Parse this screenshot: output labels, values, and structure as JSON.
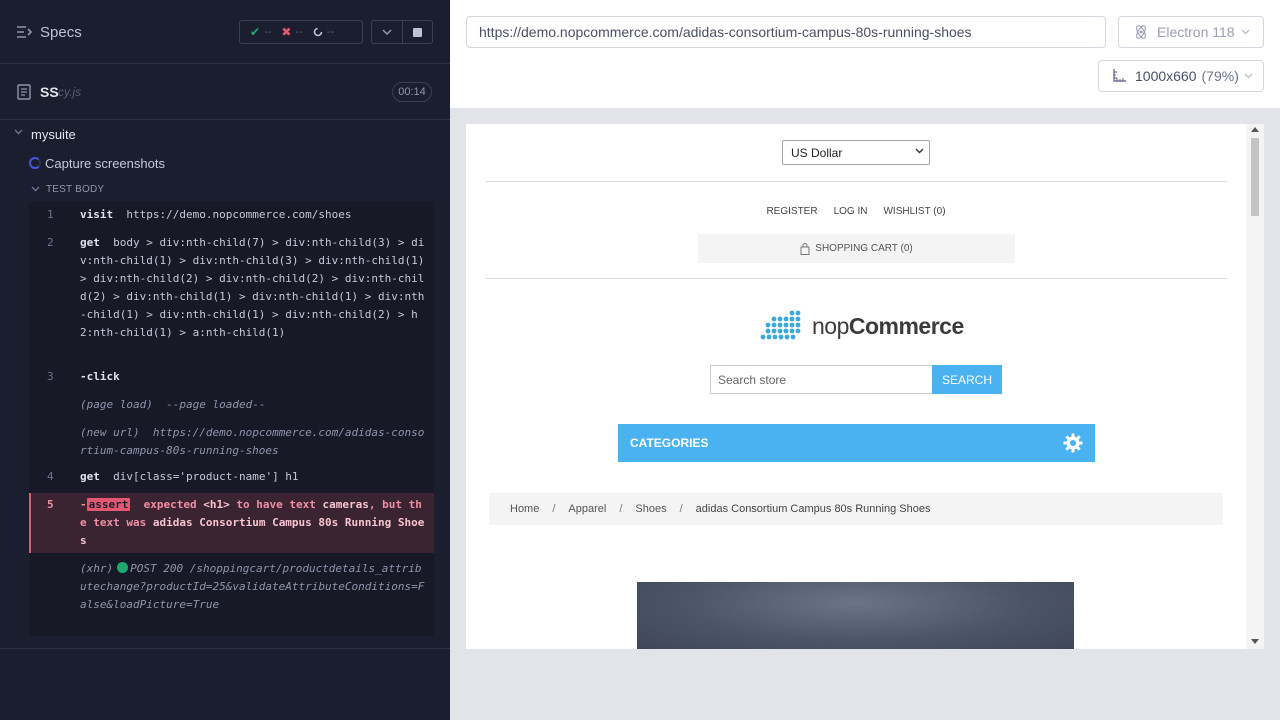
{
  "reporter": {
    "header": {
      "title": "Specs",
      "stats": {
        "passed": "--",
        "failed": "--",
        "pending": "--"
      }
    },
    "file": {
      "name": "SS",
      "ext": "cy.js",
      "duration": "00:14"
    },
    "suite": {
      "title": "mysuite"
    },
    "test": {
      "title": "Capture screenshots"
    },
    "body_label": "TEST BODY",
    "commands": [
      {
        "num": "1",
        "name": "visit",
        "message": "https://demo.nopcommerce.com/shoes"
      },
      {
        "num": "2",
        "name": "get",
        "message": "body > div:nth-child(7) > div:nth-child(3) > div:nth-child(1) > div:nth-child(3) > div:nth-child(1) > div:nth-child(2) > div:nth-child(2) > div:nth-child(2) > div:nth-child(1) > div:nth-child(1) > div:nth-child(1) > div:nth-child(1) > div:nth-child(2) > h2:nth-child(1) > a:nth-child(1)"
      },
      {
        "num": "3",
        "name": "-click",
        "message": ""
      },
      {
        "event": "(page load)",
        "message": "--page loaded--"
      },
      {
        "event": "(new url)",
        "message": "https://demo.nopcommerce.com/adidas-consortium-campus-80s-running-shoes"
      },
      {
        "num": "4",
        "name": "get",
        "message": "div[class='product-name'] h1"
      },
      {
        "num": "5",
        "prefix": "-",
        "tag": "assert",
        "part1": "expected",
        "el": "<h1>",
        "part2": "to have text",
        "expected": "cameras",
        "comma": ",",
        "part3": "but the text was",
        "actual": "adidas Consortium Campus 80s Running Shoes"
      },
      {
        "event": "(xhr)",
        "method": "POST 200",
        "message": "/shoppingcart/productdetails_attributechange?productId=25&validateAttributeConditions=False&loadPicture=True"
      }
    ]
  },
  "aut": {
    "url": "https://demo.nopcommerce.com/adidas-consortium-campus-80s-running-shoes",
    "browser": "Electron 118",
    "viewport": "1000x660",
    "scale": "(79%)",
    "page": {
      "currency": "US Dollar",
      "header_links": [
        "REGISTER",
        "LOG IN",
        "WISHLIST (0)"
      ],
      "cart": "SHOPPING CART (0)",
      "logo": {
        "light": "nop",
        "bold": "Commerce"
      },
      "search_placeholder": "Search store",
      "search_button": "SEARCH",
      "categories": "CATEGORIES",
      "breadcrumb": [
        "Home",
        "Apparel",
        "Shoes"
      ],
      "breadcrumb_sep": "/",
      "breadcrumb_current": "adidas Consortium Campus 80s Running Shoes"
    }
  },
  "colors": {
    "reporter_bg": "#1b1e2e",
    "pass": "#1fa971",
    "fail": "#e45770",
    "running": "#4956e3",
    "accent_blue": "#4ab2f1"
  }
}
